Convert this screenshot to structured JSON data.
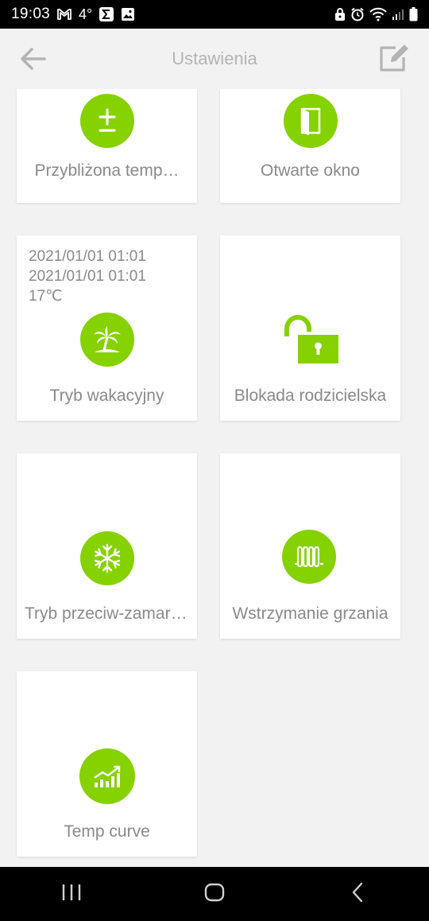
{
  "status_bar": {
    "time": "19:03",
    "temperature": "4°",
    "left_icons": [
      "gmail-icon",
      "sigma-icon",
      "image-icon"
    ],
    "right_icons": [
      "vpn-icon",
      "alarm-icon",
      "wifi-icon",
      "signal-icon",
      "battery-icon"
    ]
  },
  "header": {
    "title": "Ustawienia",
    "back_icon": "arrow-left-icon",
    "edit_icon": "edit-icon"
  },
  "cards": [
    {
      "label": "Przybliżona temp…",
      "icon": "plus-minus-icon"
    },
    {
      "label": "Otwarte okno",
      "icon": "window-icon"
    },
    {
      "label": "Tryb wakacyjny",
      "icon": "palm-tree-icon",
      "details": [
        "2021/01/01 01:01",
        "2021/01/01 01:01",
        "17℃"
      ]
    },
    {
      "label": "Blokada rodzicielska",
      "icon": "lock-open-icon"
    },
    {
      "label": "Tryb przeciw-zamarzaniu",
      "icon": "snowflake-icon"
    },
    {
      "label": "Wstrzymanie grzania",
      "icon": "radiator-icon"
    },
    {
      "label": "Temp curve",
      "icon": "chart-up-icon"
    }
  ],
  "colors": {
    "accent": "#86d100",
    "background": "#f2f2f2",
    "card": "#ffffff",
    "text": "#8a8a8a",
    "header_text": "#b4b4b4"
  },
  "nav_bar": {
    "icons": [
      "recent-apps-icon",
      "home-icon",
      "back-icon"
    ]
  }
}
